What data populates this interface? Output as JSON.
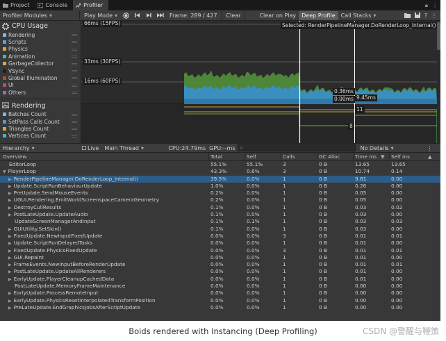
{
  "tabs": [
    {
      "label": "Project",
      "icon": "folder-icon"
    },
    {
      "label": "Console",
      "icon": "console-icon"
    },
    {
      "label": "Profiler",
      "icon": "profiler-icon",
      "active": true
    }
  ],
  "toolbar": {
    "modules_dropdown": "Profiler Modules",
    "play_mode": "Play Mode",
    "frame": "Frame: 289 / 427",
    "clear": "Clear",
    "clear_on_play": "Clear on Play",
    "deep_profile": "Deep Profile",
    "call_stacks": "Call Stacks"
  },
  "cpu_module": {
    "title": "CPU Usage",
    "items": [
      {
        "label": "Rendering",
        "color": "#7fb8e6"
      },
      {
        "label": "Scripts",
        "color": "#5aa0d8"
      },
      {
        "label": "Physics",
        "color": "#e3a13c"
      },
      {
        "label": "Animation",
        "color": "#3fb6c6"
      },
      {
        "label": "GarbageCollector",
        "color": "#c9b23d"
      },
      {
        "label": "VSync",
        "color": "#1f1f1f"
      },
      {
        "label": "Global Illumination",
        "color": "#b04d2e"
      },
      {
        "label": "UI",
        "color": "#b84a7a"
      },
      {
        "label": "Others",
        "color": "#8a6fb8"
      }
    ]
  },
  "rendering_module": {
    "title": "Rendering",
    "items": [
      {
        "label": "Batches Count",
        "color": "#7fb8e6"
      },
      {
        "label": "SetPass Calls Count",
        "color": "#4f9ad0"
      },
      {
        "label": "Triangles Count",
        "color": "#e3a13c"
      },
      {
        "label": "Vertices Count",
        "color": "#3fb6c6"
      }
    ]
  },
  "graph": {
    "label_66": "66ms (15FPS)",
    "label_33": "33ms (30FPS)",
    "label_16": "16ms (60FPS)",
    "selected": "Selected: RenderPipelineManager.DoRenderLoop_Internal()",
    "val_a": "0.36ms",
    "val_b": "0.00ms",
    "val_c": "9.45ms",
    "render_a": "11",
    "render_b": "8"
  },
  "hierarchy_bar": {
    "view": "Hierarchy",
    "live": "Live",
    "thread": "Main Thread",
    "cpu": "CPU:24.79ms",
    "gpu": "GPU:--ms",
    "details": "No Details"
  },
  "table": {
    "headers": [
      "Overview",
      "Total",
      "Self",
      "Calls",
      "GC Alloc",
      "Time ms",
      "Self ms"
    ],
    "rows": [
      {
        "name": "EditorLoop",
        "indent": 0,
        "caret": false,
        "total": "55.1%",
        "self": "55.1%",
        "calls": "3",
        "gc": "0 B",
        "time": "13.65",
        "selfms": "13.65"
      },
      {
        "name": "PlayerLoop",
        "indent": 0,
        "caret": true,
        "open": true,
        "total": "43.3%",
        "self": "0.6%",
        "calls": "3",
        "gc": "0 B",
        "time": "10.74",
        "selfms": "0.14"
      },
      {
        "name": "RenderPipelineManager.DoRenderLoop_Internal()",
        "indent": 1,
        "caret": true,
        "sel": true,
        "total": "39.5%",
        "self": "0.0%",
        "calls": "1",
        "gc": "0 B",
        "time": "9.81",
        "selfms": "0.00"
      },
      {
        "name": "Update.ScriptRunBehaviourUpdate",
        "indent": 1,
        "caret": true,
        "total": "1.0%",
        "self": "0.0%",
        "calls": "1",
        "gc": "0 B",
        "time": "0.26",
        "selfms": "0.00"
      },
      {
        "name": "PreUpdate.SendMouseEvents",
        "indent": 1,
        "caret": true,
        "total": "0.2%",
        "self": "0.0%",
        "calls": "1",
        "gc": "0 B",
        "time": "0.05",
        "selfms": "0.00"
      },
      {
        "name": "UGUI.Rendering.EmitWorldScreenspaceCameraGeometry",
        "indent": 1,
        "caret": true,
        "total": "0.2%",
        "self": "0.0%",
        "calls": "1",
        "gc": "0 B",
        "time": "0.05",
        "selfms": "0.00"
      },
      {
        "name": "DestroyCullResults",
        "indent": 1,
        "caret": true,
        "total": "0.1%",
        "self": "0.0%",
        "calls": "1",
        "gc": "0 B",
        "time": "0.03",
        "selfms": "0.02"
      },
      {
        "name": "PostLateUpdate.UpdateAudio",
        "indent": 1,
        "caret": true,
        "total": "0.1%",
        "self": "0.0%",
        "calls": "1",
        "gc": "0 B",
        "time": "0.03",
        "selfms": "0.00"
      },
      {
        "name": "UpdateScreenManagerAndInput",
        "indent": 1,
        "caret": false,
        "total": "0.1%",
        "self": "0.1%",
        "calls": "1",
        "gc": "0 B",
        "time": "0.03",
        "selfms": "0.03"
      },
      {
        "name": "GUIUtility.SetSkin()",
        "indent": 1,
        "caret": true,
        "total": "0.1%",
        "self": "0.0%",
        "calls": "1",
        "gc": "0 B",
        "time": "0.03",
        "selfms": "0.00"
      },
      {
        "name": "FixedUpdate.NewInputFixedUpdate",
        "indent": 1,
        "caret": true,
        "total": "0.0%",
        "self": "0.0%",
        "calls": "3",
        "gc": "0 B",
        "time": "0.01",
        "selfms": "0.01"
      },
      {
        "name": "Update.ScriptRunDelayedTasks",
        "indent": 1,
        "caret": true,
        "total": "0.0%",
        "self": "0.0%",
        "calls": "1",
        "gc": "0 B",
        "time": "0.01",
        "selfms": "0.00"
      },
      {
        "name": "FixedUpdate.PhysicsFixedUpdate",
        "indent": 1,
        "caret": true,
        "total": "0.0%",
        "self": "0.0%",
        "calls": "3",
        "gc": "0 B",
        "time": "0.01",
        "selfms": "0.01"
      },
      {
        "name": "GUI.Repaint",
        "indent": 1,
        "caret": true,
        "total": "0.0%",
        "self": "0.0%",
        "calls": "1",
        "gc": "0 B",
        "time": "0.01",
        "selfms": "0.00"
      },
      {
        "name": "FrameEvents.NewInputBeforeRenderUpdate",
        "indent": 1,
        "caret": true,
        "total": "0.0%",
        "self": "0.0%",
        "calls": "1",
        "gc": "0 B",
        "time": "0.01",
        "selfms": "0.01"
      },
      {
        "name": "PostLateUpdate.UpdateAllRenderers",
        "indent": 1,
        "caret": true,
        "total": "0.0%",
        "self": "0.0%",
        "calls": "1",
        "gc": "0 B",
        "time": "0.01",
        "selfms": "0.00"
      },
      {
        "name": "EarlyUpdate.PlayerCleanupCachedData",
        "indent": 1,
        "caret": true,
        "total": "0.0%",
        "self": "0.0%",
        "calls": "1",
        "gc": "0 B",
        "time": "0.01",
        "selfms": "0.00"
      },
      {
        "name": "PostLateUpdate.MemoryFrameMaintenance",
        "indent": 1,
        "caret": false,
        "total": "0.0%",
        "self": "0.0%",
        "calls": "1",
        "gc": "0 B",
        "time": "0.00",
        "selfms": "0.00"
      },
      {
        "name": "EarlyUpdate.ProcessRemoteInput",
        "indent": 1,
        "caret": true,
        "total": "0.0%",
        "self": "0.0%",
        "calls": "1",
        "gc": "0 B",
        "time": "0.00",
        "selfms": "0.00"
      },
      {
        "name": "EarlyUpdate.PhysicsResetInterpolatedTransformPosition",
        "indent": 1,
        "caret": true,
        "total": "0.0%",
        "self": "0.0%",
        "calls": "1",
        "gc": "0 B",
        "time": "0.00",
        "selfms": "0.00"
      },
      {
        "name": "PreLateUpdate.EndGraphicsJobsAfterScriptUpdate",
        "indent": 1,
        "caret": true,
        "total": "0.0%",
        "self": "0.0%",
        "calls": "1",
        "gc": "0 B",
        "time": "0.00",
        "selfms": "0.00"
      }
    ]
  },
  "caption": "Boids rendered with Instancing (Deep Profiling)",
  "watermark": "CSDN @警醒与鞭策"
}
